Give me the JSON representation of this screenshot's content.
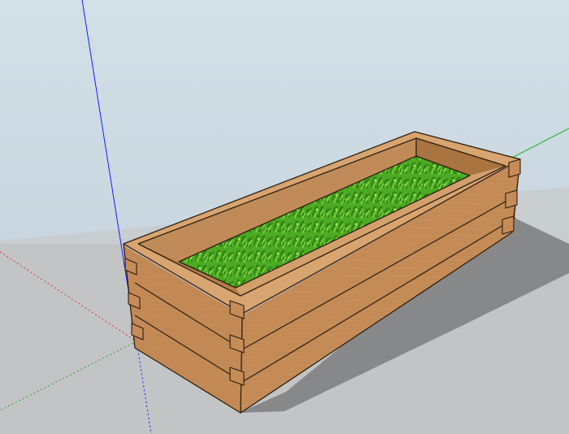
{
  "scene": {
    "subject": "wooden-planter-box-with-grass",
    "colors": {
      "sky": "#d0dde6",
      "ground": "#c2c3c4",
      "shadow": "#868789",
      "axis_blue": "#1a1aff",
      "axis_green": "#11b811",
      "axis_red": "#e03030",
      "wood_front": "#c88f5c",
      "wood_side": "#b87f4d",
      "wood_top": "#d9a672",
      "wood_inner": "#bf8a57",
      "wood_inner_dark": "#a9743f",
      "edge": "#2b1e12",
      "grass_dark": "#2e7d14",
      "grass_mid": "#52b326",
      "grass_light": "#8fe04a"
    }
  }
}
